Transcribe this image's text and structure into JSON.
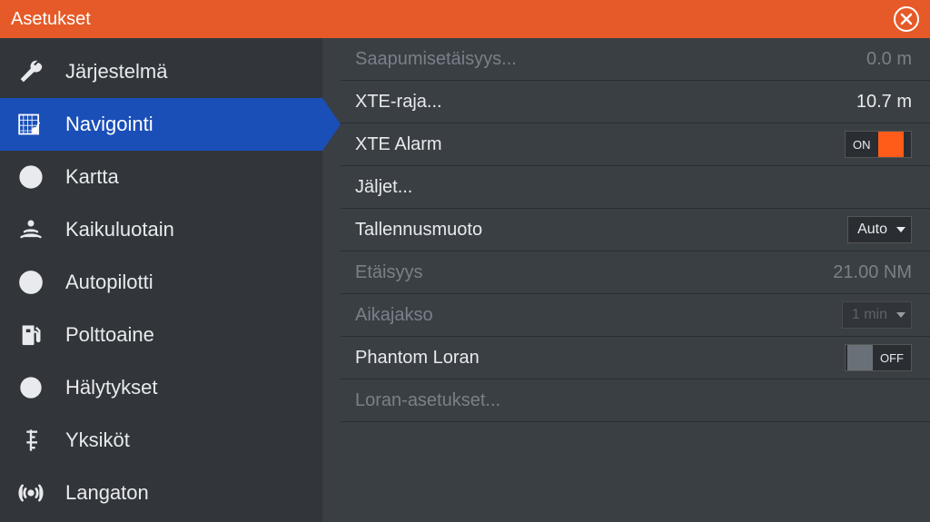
{
  "title": "Asetukset",
  "sidebar": {
    "items": [
      {
        "label": "Järjestelmä"
      },
      {
        "label": "Navigointi"
      },
      {
        "label": "Kartta"
      },
      {
        "label": "Kaikuluotain"
      },
      {
        "label": "Autopilotti"
      },
      {
        "label": "Polttoaine"
      },
      {
        "label": "Hälytykset"
      },
      {
        "label": "Yksiköt"
      },
      {
        "label": "Langaton"
      }
    ],
    "active_index": 1
  },
  "settings": {
    "arrival_distance": {
      "label": "Saapumisetäisyys...",
      "value": "0.0 m"
    },
    "xte_limit": {
      "label": "XTE-raja...",
      "value": "10.7 m"
    },
    "xte_alarm": {
      "label": "XTE Alarm",
      "state": "ON"
    },
    "tracks": {
      "label": "Jäljet..."
    },
    "log_format": {
      "label": "Tallennusmuoto",
      "value": "Auto"
    },
    "distance": {
      "label": "Etäisyys",
      "value": "21.00 NM"
    },
    "time_period": {
      "label": "Aikajakso",
      "value": "1 min"
    },
    "phantom_loran": {
      "label": "Phantom Loran",
      "state": "OFF"
    },
    "loran_settings": {
      "label": "Loran-asetukset..."
    }
  }
}
